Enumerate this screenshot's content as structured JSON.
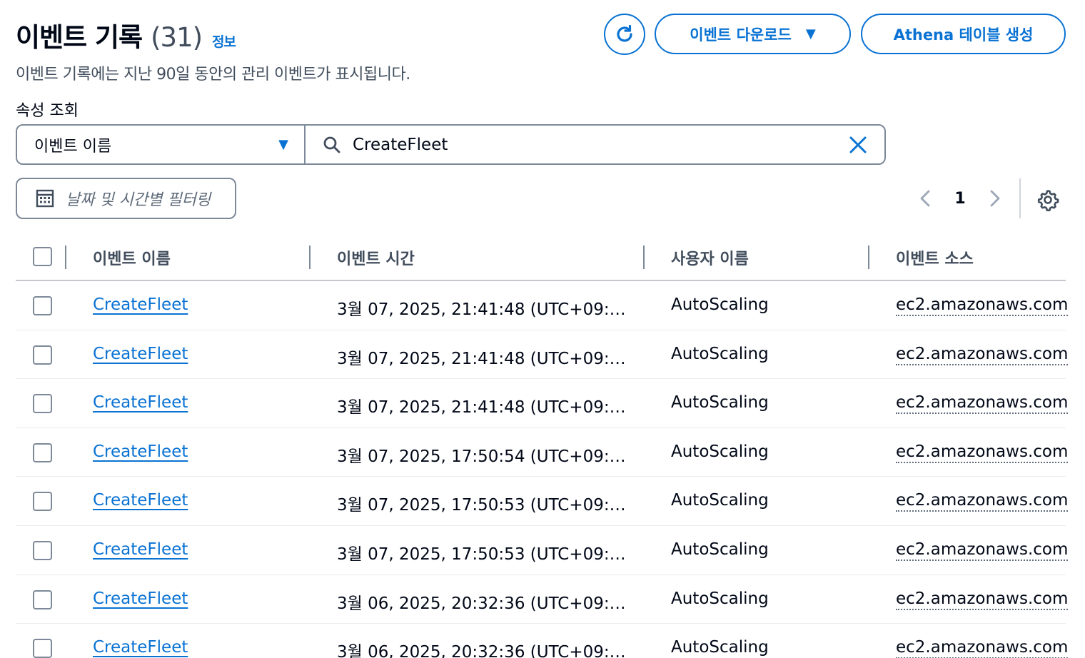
{
  "header": {
    "title": "이벤트 기록",
    "count": "(31)",
    "info_link": "정보",
    "download_label": "이벤트 다운로드",
    "athena_label": "Athena 테이블 생성",
    "description": "이벤트 기록에는 지난 90일 동안의 관리 이벤트가 표시됩니다."
  },
  "filter": {
    "label": "속성 조회",
    "attribute": "이벤트 이름",
    "search_value": "CreateFleet",
    "date_filter_placeholder": "날짜 및 시간별 필터링"
  },
  "pagination": {
    "current_page": "1"
  },
  "table": {
    "columns": [
      "이벤트 이름",
      "이벤트 시간",
      "사용자 이름",
      "이벤트 소스"
    ],
    "rows": [
      {
        "name": "CreateFleet",
        "time": "3월 07, 2025, 21:41:48 (UTC+09:…",
        "user": "AutoScaling",
        "source": "ec2.amazonaws.com"
      },
      {
        "name": "CreateFleet",
        "time": "3월 07, 2025, 21:41:48 (UTC+09:…",
        "user": "AutoScaling",
        "source": "ec2.amazonaws.com"
      },
      {
        "name": "CreateFleet",
        "time": "3월 07, 2025, 21:41:48 (UTC+09:…",
        "user": "AutoScaling",
        "source": "ec2.amazonaws.com"
      },
      {
        "name": "CreateFleet",
        "time": "3월 07, 2025, 17:50:54 (UTC+09:…",
        "user": "AutoScaling",
        "source": "ec2.amazonaws.com"
      },
      {
        "name": "CreateFleet",
        "time": "3월 07, 2025, 17:50:53 (UTC+09:…",
        "user": "AutoScaling",
        "source": "ec2.amazonaws.com"
      },
      {
        "name": "CreateFleet",
        "time": "3월 07, 2025, 17:50:53 (UTC+09:…",
        "user": "AutoScaling",
        "source": "ec2.amazonaws.com"
      },
      {
        "name": "CreateFleet",
        "time": "3월 06, 2025, 20:32:36 (UTC+09:…",
        "user": "AutoScaling",
        "source": "ec2.amazonaws.com"
      },
      {
        "name": "CreateFleet",
        "time": "3월 06, 2025, 20:32:36 (UTC+09:…",
        "user": "AutoScaling",
        "source": "ec2.amazonaws.com"
      }
    ]
  },
  "icons": [
    "refresh-icon",
    "caret-down-icon",
    "search-icon",
    "close-icon",
    "calendar-icon",
    "chevron-left-icon",
    "chevron-right-icon",
    "gear-icon"
  ],
  "colors": {
    "accent": "#0972d3",
    "text": "#000716",
    "muted": "#414d5c",
    "border": "#7d8998"
  }
}
